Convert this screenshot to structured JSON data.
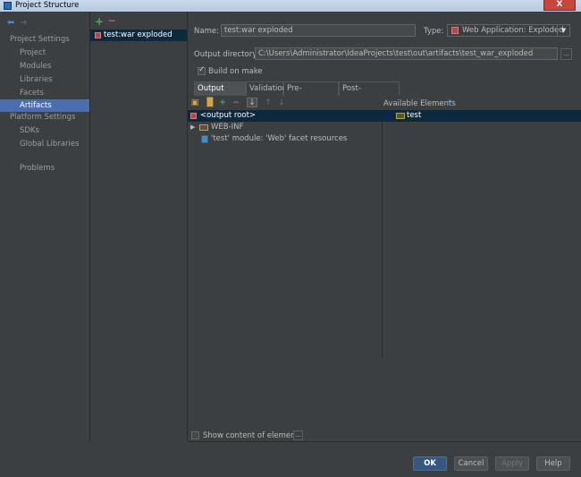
{
  "window": {
    "title": "Project Structure",
    "close_label": "X"
  },
  "sidebar": {
    "project_settings_header": "Project Settings",
    "project_settings_items": [
      {
        "label": "Project"
      },
      {
        "label": "Modules"
      },
      {
        "label": "Libraries"
      },
      {
        "label": "Facets"
      },
      {
        "label": "Artifacts",
        "selected": true
      }
    ],
    "platform_settings_header": "Platform Settings",
    "platform_settings_items": [
      {
        "label": "SDKs"
      },
      {
        "label": "Global Libraries"
      }
    ],
    "problems_label": "Problems"
  },
  "artifacts": {
    "items": [
      {
        "label": "test:war exploded",
        "selected": true
      }
    ]
  },
  "form": {
    "name_label": "Name:",
    "name_value": "test:war exploded",
    "type_label": "Type:",
    "type_value": "Web Application: Exploded",
    "output_dir_label": "Output directory:",
    "output_dir_value": "C:\\Users\\Administrator\\IdeaProjects\\test\\out\\artifacts\\test_war_exploded",
    "browse_label": "...",
    "build_on_make_label": "Build on make",
    "build_on_make_checked": true
  },
  "tabs": [
    {
      "label": "Output Layout",
      "active": true
    },
    {
      "label": "Validation"
    },
    {
      "label": "Pre-processing"
    },
    {
      "label": "Post-processing"
    }
  ],
  "layout_tree": {
    "rows": [
      {
        "label": "<output root>",
        "selected": true
      },
      {
        "label": "WEB-INF",
        "expand": "▶"
      },
      {
        "label": "'test' module: 'Web' facet resources"
      }
    ]
  },
  "available_elements": {
    "header": "Available Elements",
    "help": "?",
    "items": [
      {
        "label": "test"
      }
    ]
  },
  "show_content_label": "Show content of elements",
  "show_content_checked": false,
  "show_content_more": "...",
  "footer": {
    "ok": "OK",
    "cancel": "Cancel",
    "apply": "Apply",
    "help": "Help"
  },
  "colors": {
    "background": "#3c3f41",
    "selection": "#4b6eaf",
    "tree_selection": "#0d293e",
    "primary_button": "#365880"
  }
}
